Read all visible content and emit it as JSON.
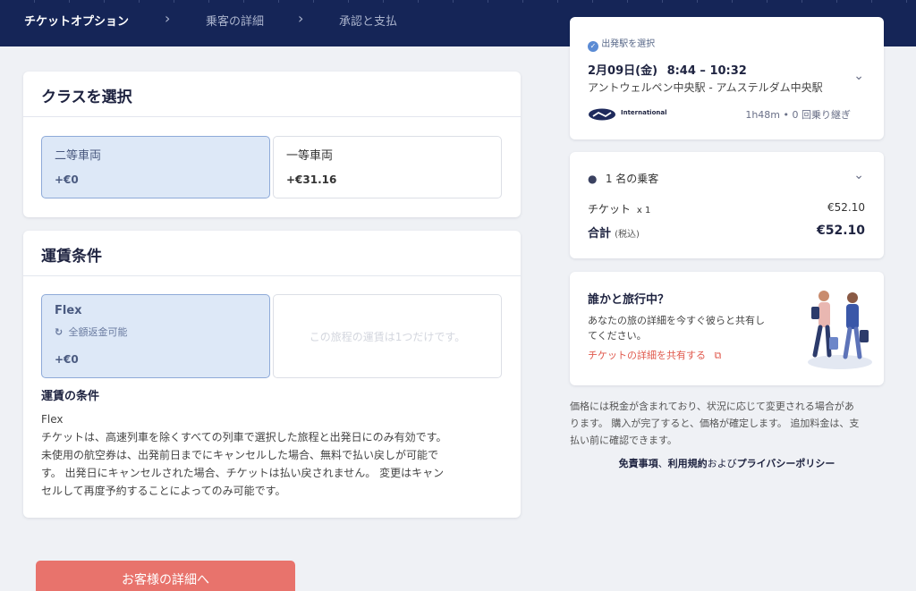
{
  "nav": {
    "steps": [
      "チケットオプション",
      "乗客の詳細",
      "承認と支払"
    ]
  },
  "class_section": {
    "title": "クラスを選択",
    "options": [
      {
        "name": "二等車両",
        "price": "+€0",
        "selected": true
      },
      {
        "name": "一等車両",
        "price": "+€31.16",
        "selected": false
      }
    ]
  },
  "fare_section": {
    "title": "運賃条件",
    "flex": {
      "name": "Flex",
      "feature": "全額返金可能",
      "price": "+€0"
    },
    "only_one_note": "この旅程の運賃は1つだけです。",
    "conditions_heading": "運賃の条件",
    "conditions_name": "Flex",
    "conditions_lines": [
      "チケットは、高速列車を除くすべての列車で選択した旅程と出発日にのみ有効です。",
      "未使用の航空券は、出発前日までにキャンセルした場合、無料で払い戻しが可能で",
      "す。 出発日にキャンセルされた場合、チケットは払い戻されません。 変更はキャン",
      "セルして再度予約することによってのみ可能です。"
    ]
  },
  "cta": {
    "label": "お客様の詳細へ"
  },
  "journey": {
    "check_label": "出発駅を選択",
    "date": "2月09日(金)",
    "time": "8:44 – 10:32",
    "route": "アントウェルペン中央駅 - アムステルダム中央駅",
    "operator": "International",
    "duration": "1h48m • 0 回乗り継ぎ"
  },
  "passengers": {
    "label": "1 名の乗客",
    "ticket_label": "チケット",
    "ticket_qty": "x 1",
    "ticket_price": "€52.10",
    "total_label": "合計",
    "total_tax": "(税込)",
    "total_price": "€52.10"
  },
  "share": {
    "title": "誰かと旅行中？",
    "desc1": "あなたの旅の詳細を今すぐ彼らと共有し",
    "desc2": "てください。",
    "link": "チケットの詳細を共有する"
  },
  "disclaimer": {
    "line1": "価格には税金が含まれており、状況に応じて変更される場合があ",
    "line2": "ります。 購入が完了すると、価格が確定します。 追加料金は、支",
    "line3": "払い前に確認できます。",
    "links": {
      "disclaimer": "免責事項",
      "sep": "、",
      "terms": "利用規約",
      "and": "および",
      "privacy": "プライバシーポリシー"
    }
  },
  "colors": {
    "nav_bg": "#152557",
    "selected_bg": "#dde8f7",
    "cta": "#e8736c",
    "link": "#e05a4e",
    "check": "#5b8bd4"
  }
}
